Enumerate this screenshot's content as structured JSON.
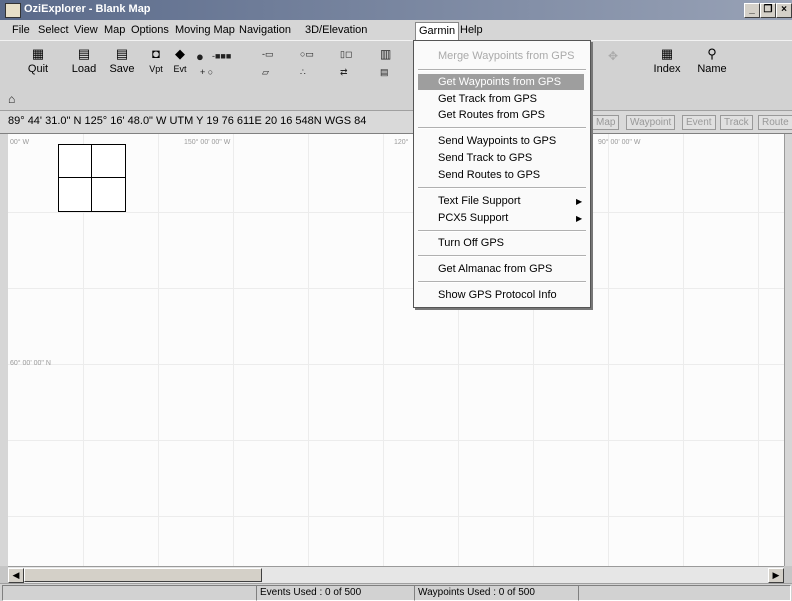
{
  "window": {
    "title": "OziExplorer - Blank Map"
  },
  "menubar": {
    "items": [
      "File",
      "Select",
      "View",
      "Map",
      "Options",
      "Moving Map",
      "Navigation",
      "3D/Elevation",
      "Garmin",
      "Help"
    ]
  },
  "toolbar": {
    "quit": "Quit",
    "load": "Load",
    "save": "Save",
    "vpt": "Vpt",
    "evt": "Evt",
    "index": "Index",
    "name": "Name"
  },
  "coords": {
    "text": "89° 44' 31.0\" N    125° 16' 48.0\" W  UTM  Y  19 76 611E   20 16 548N  WGS 84"
  },
  "tabs": [
    "Map",
    "Waypoint",
    "Event",
    "Track",
    "Route"
  ],
  "map": {
    "labels": [
      "00° W",
      "150° 00' 00\" W",
      "120°",
      "90° 00' 00\" W",
      "60° 00' 00\" N"
    ]
  },
  "garmin_menu": {
    "items": [
      "Merge Waypoints from GPS",
      "Get Waypoints from GPS",
      "Get Track from GPS",
      "Get Routes from GPS",
      "Send Waypoints to GPS",
      "Send Track to GPS",
      "Send Routes to GPS",
      "Text File Support",
      "PCX5 Support",
      "Turn Off GPS",
      "Get Almanac from GPS",
      "Show GPS Protocol Info"
    ]
  },
  "status": {
    "events": "Events Used : 0 of 500",
    "waypoints": "Waypoints Used : 0 of 500"
  },
  "colors": {
    "menu_highlight": "#9e9e9e",
    "titlebar": "#5a6a8a"
  }
}
